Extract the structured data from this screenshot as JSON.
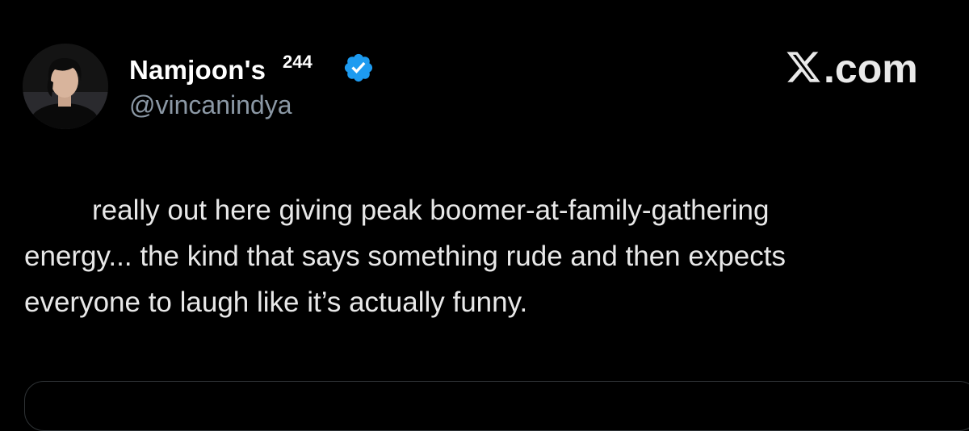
{
  "author": {
    "display_name": "Namjoon's",
    "name_superscript": "244",
    "handle": "@vincanindya",
    "verified": true
  },
  "brand": {
    "label": ".com",
    "logo_icon": "x-logo-icon"
  },
  "tweet": {
    "lines": [
      "really out here giving peak boomer-at-family-gathering",
      "energy... the kind that says something rude and then expects",
      "everyone to laugh like it’s actually funny."
    ]
  },
  "colors": {
    "background": "#000000",
    "text": "#e7e9ea",
    "handle": "#8b98a5",
    "verified_badge": "#1d9bf0"
  }
}
